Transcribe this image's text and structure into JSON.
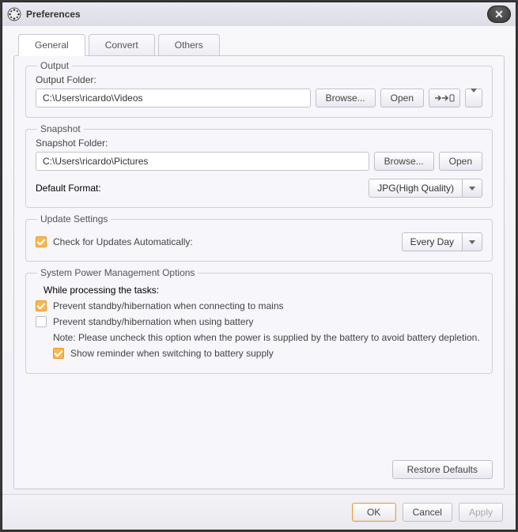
{
  "title": "Preferences",
  "tabs": {
    "general": "General",
    "convert": "Convert",
    "others": "Others"
  },
  "output": {
    "legend": "Output",
    "folder_label": "Output Folder:",
    "folder_value": "C:\\Users\\ricardo\\Videos",
    "browse": "Browse...",
    "open": "Open"
  },
  "snapshot": {
    "legend": "Snapshot",
    "folder_label": "Snapshot Folder:",
    "folder_value": "C:\\Users\\ricardo\\Pictures",
    "browse": "Browse...",
    "open": "Open",
    "format_label": "Default Format:",
    "format_value": "JPG(High Quality)"
  },
  "updates": {
    "legend": "Update Settings",
    "check_label": "Check for Updates Automatically:",
    "freq_value": "Every Day"
  },
  "power": {
    "legend": "System Power Management Options",
    "while": "While processing the tasks:",
    "opt_mains": "Prevent standby/hibernation when connecting to mains",
    "opt_battery": "Prevent standby/hibernation when using battery",
    "note": "Note: Please uncheck this option when the power is supplied by the battery to avoid battery depletion.",
    "reminder": "Show reminder when switching to battery supply"
  },
  "restore": "Restore Defaults",
  "ok": "OK",
  "cancel": "Cancel",
  "apply": "Apply"
}
